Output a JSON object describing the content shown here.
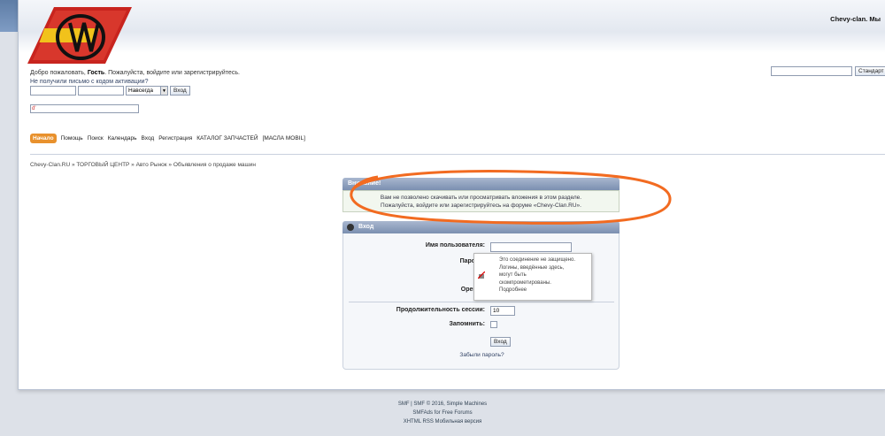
{
  "site": {
    "title": "Chevy-clan. Мы"
  },
  "welcome": {
    "prefix": "Добро пожаловать, ",
    "guest": "Гость",
    "suffix": ". Пожалуйста, войдите или зарегистрируйтесь.",
    "activation": "Не получили письмо с кодом активации?"
  },
  "login_bar": {
    "duration": "Навсегда",
    "login_button": "Вход"
  },
  "news_input": {
    "value": "d'"
  },
  "search": {
    "button": "Стандарт"
  },
  "menu": [
    {
      "label": "Начало",
      "active": true
    },
    {
      "label": "Помощь"
    },
    {
      "label": "Поиск"
    },
    {
      "label": "Календарь"
    },
    {
      "label": "Вход"
    },
    {
      "label": "Регистрация"
    },
    {
      "label": "КАТАЛОГ ЗАПЧАСТЕЙ"
    },
    {
      "label": "[МАСЛА MOBIL]"
    }
  ],
  "breadcrumb": "Chevy-Clan.RU » ТОРГОВЫЙ ЦЕНТР » Авто Рынок » Объявления о продаже машин",
  "notice": {
    "title": "Внимание!",
    "line1": "Вам не позволено скачивать или просматривать вложения в этом разделе.",
    "line2": "Пожалуйста, войдите или зарегистрируйтесь на форуме «Chevy-Clan.RU»."
  },
  "login": {
    "title": "Вход",
    "username_label": "Имя пользователя:",
    "password_label": "Пароль:",
    "openid_label": "OpenID:",
    "session_label": "Продолжительность сессии:",
    "session_value": "10",
    "remember_label": "Запомнить:",
    "submit": "Вход",
    "forgot": "Забыли пароль?"
  },
  "tooltip": {
    "line1": "Это соединение не защищено.",
    "line2": "Логины, введённые здесь,",
    "line3": "могут быть",
    "line4": "скомпрометированы.",
    "line5": "Подробнее"
  },
  "footer": {
    "line1": "SMF | SMF © 2016, Simple Machines",
    "line2": "SMFAds for Free Forums",
    "line3": "XHTML   RSS   Мобильная версия"
  },
  "colors": {
    "accent": "#e8912d",
    "header": "#7b8fb0",
    "ellipse": "#f26b21"
  }
}
